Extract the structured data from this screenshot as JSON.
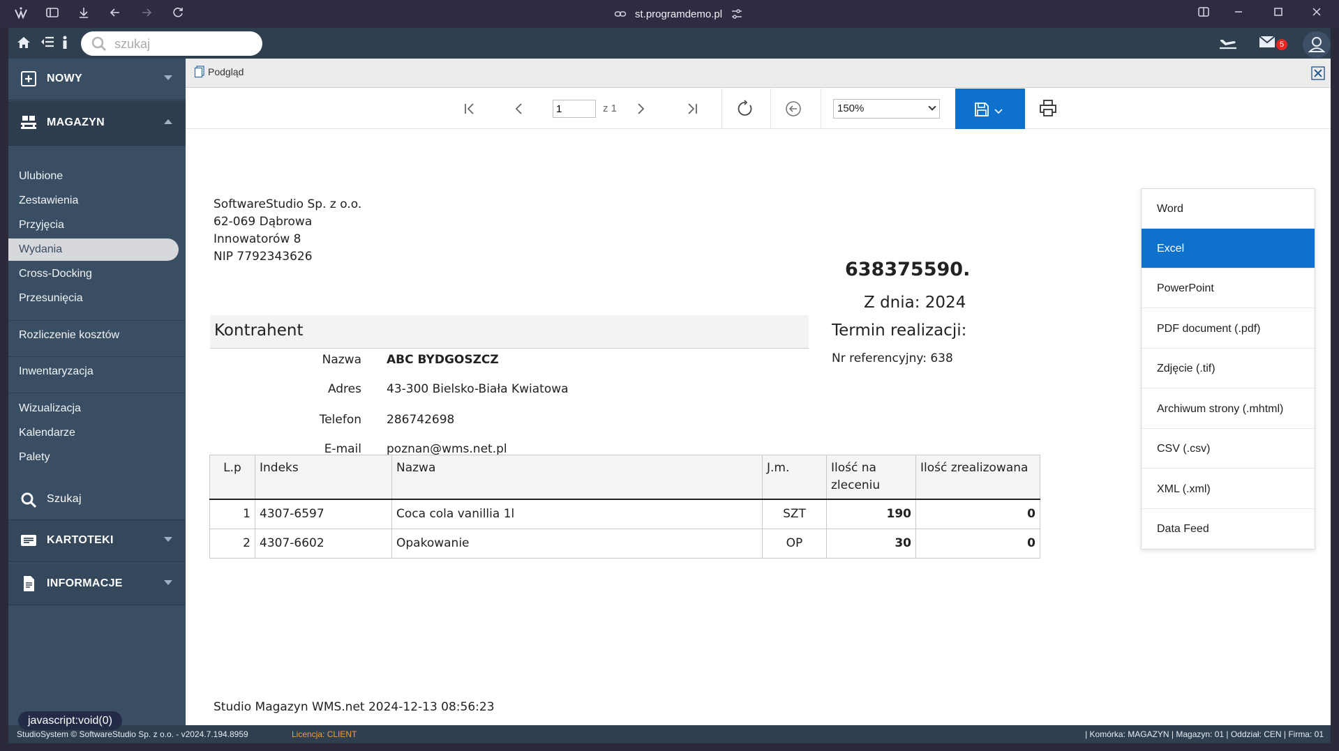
{
  "browser": {
    "url": "st.programdemo.pl"
  },
  "topbar": {
    "search_placeholder": "szukaj",
    "mail_count": "5"
  },
  "sidebar": {
    "nowy": "NOWY",
    "magazyn": "MAGAZYN",
    "items": [
      "Ulubione",
      "Zestawienia",
      "Przyjęcia",
      "Wydania",
      "Cross-Docking",
      "Przesunięcia"
    ],
    "rozliczenie": "Rozliczenie kosztów",
    "inwentaryzacja": "Inwentaryzacja",
    "group2": [
      "Wizualizacja",
      "Kalendarze",
      "Palety"
    ],
    "szukaj": "Szukaj",
    "kartoteki": "KARTOTEKI",
    "informacje": "INFORMACJE"
  },
  "tab": {
    "title": "Podgląd"
  },
  "toolbar": {
    "page_value": "1",
    "of_total": "z 1",
    "zoom": "150%"
  },
  "document": {
    "address": [
      "SoftwareStudio Sp. z o.o.",
      "62-069 Dąbrowa",
      "Innowatorów 8",
      "NIP 7792343626"
    ],
    "number": "638375590.",
    "date": "Z dnia: 2024",
    "termin": "Termin realizacji:",
    "ref": "Nr referencyjny: 638",
    "kontrahent_label": "Kontrahent",
    "kontrahent": [
      {
        "label": "Nazwa",
        "value": "ABC BYDGOSZCZ"
      },
      {
        "label": "Adres",
        "value": "43-300 Bielsko-Biała Kwiatowa"
      },
      {
        "label": "Telefon",
        "value": "286742698"
      },
      {
        "label": "E-mail",
        "value": "poznan@wms.net.pl"
      }
    ],
    "table": {
      "headers": [
        "L.p",
        "Indeks",
        "Nazwa",
        "J.m.",
        "Ilość na zleceniu",
        "Ilość zrealizowana"
      ],
      "rows": [
        [
          "1",
          "4307-6597",
          "Coca cola vanillia 1l",
          "SZT",
          "190",
          "0"
        ],
        [
          "2",
          "4307-6602",
          "Opakowanie",
          "OP",
          "30",
          "0"
        ]
      ]
    },
    "footer": "Studio Magazyn WMS.net 2024-12-13 08:56:23"
  },
  "export_menu": {
    "items": [
      "Word",
      "Excel",
      "PowerPoint",
      "PDF document (.pdf)",
      "Zdjęcie (.tif)",
      "Archiwum strony (.mhtml)",
      "CSV (.csv)",
      "XML (.xml)",
      "Data Feed"
    ],
    "selected": "Excel"
  },
  "statusbar": {
    "left": "StudioSystem © SoftwareStudio Sp. z o.o. - v2024.7.194.8959",
    "license": "Licencja: CLIENT",
    "right": "| Komórka: MAGAZYN | Magazyn: 01 | Oddział: CEN | Firma: 01"
  },
  "tooltip": "javascript:void(0)",
  "colors": {
    "accent": "#0e72cc",
    "sidebar": "#3a4e63",
    "license": "#f0a030"
  }
}
